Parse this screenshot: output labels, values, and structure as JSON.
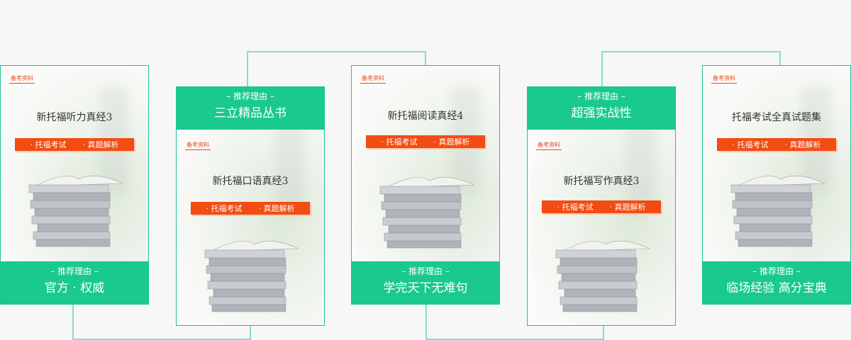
{
  "colors": {
    "accent_green": "#19c98d",
    "ribbon_orange": "#f24c12",
    "border_green": "#19c493"
  },
  "cards": [
    {
      "tag": "备考资料",
      "title": "新托福听力真经3",
      "ribbon": [
        "托福考试",
        "真题解析"
      ],
      "reason_label": "– 推荐理由 –",
      "reason": "官方 · 权威"
    },
    {
      "tag": "备考资料",
      "title": "新托福口语真经3",
      "ribbon": [
        "托福考试",
        "真题解析"
      ],
      "reason_label": "– 推荐理由 –",
      "reason": "三立精品丛书"
    },
    {
      "tag": "备考资料",
      "title": "新托福阅读真经4",
      "ribbon": [
        "托福考试",
        "真题解析"
      ],
      "reason_label": "– 推荐理由 –",
      "reason": "学完天下无难句"
    },
    {
      "tag": "备考资料",
      "title": "新托福写作真经3",
      "ribbon": [
        "托福考试",
        "真题解析"
      ],
      "reason_label": "– 推荐理由 –",
      "reason": "超强实战性"
    },
    {
      "tag": "备考资料",
      "title": "托福考试全真试题集",
      "ribbon": [
        "托福考试",
        "真题解析"
      ],
      "reason_label": "– 推荐理由 –",
      "reason": "临场经验 高分宝典"
    }
  ]
}
